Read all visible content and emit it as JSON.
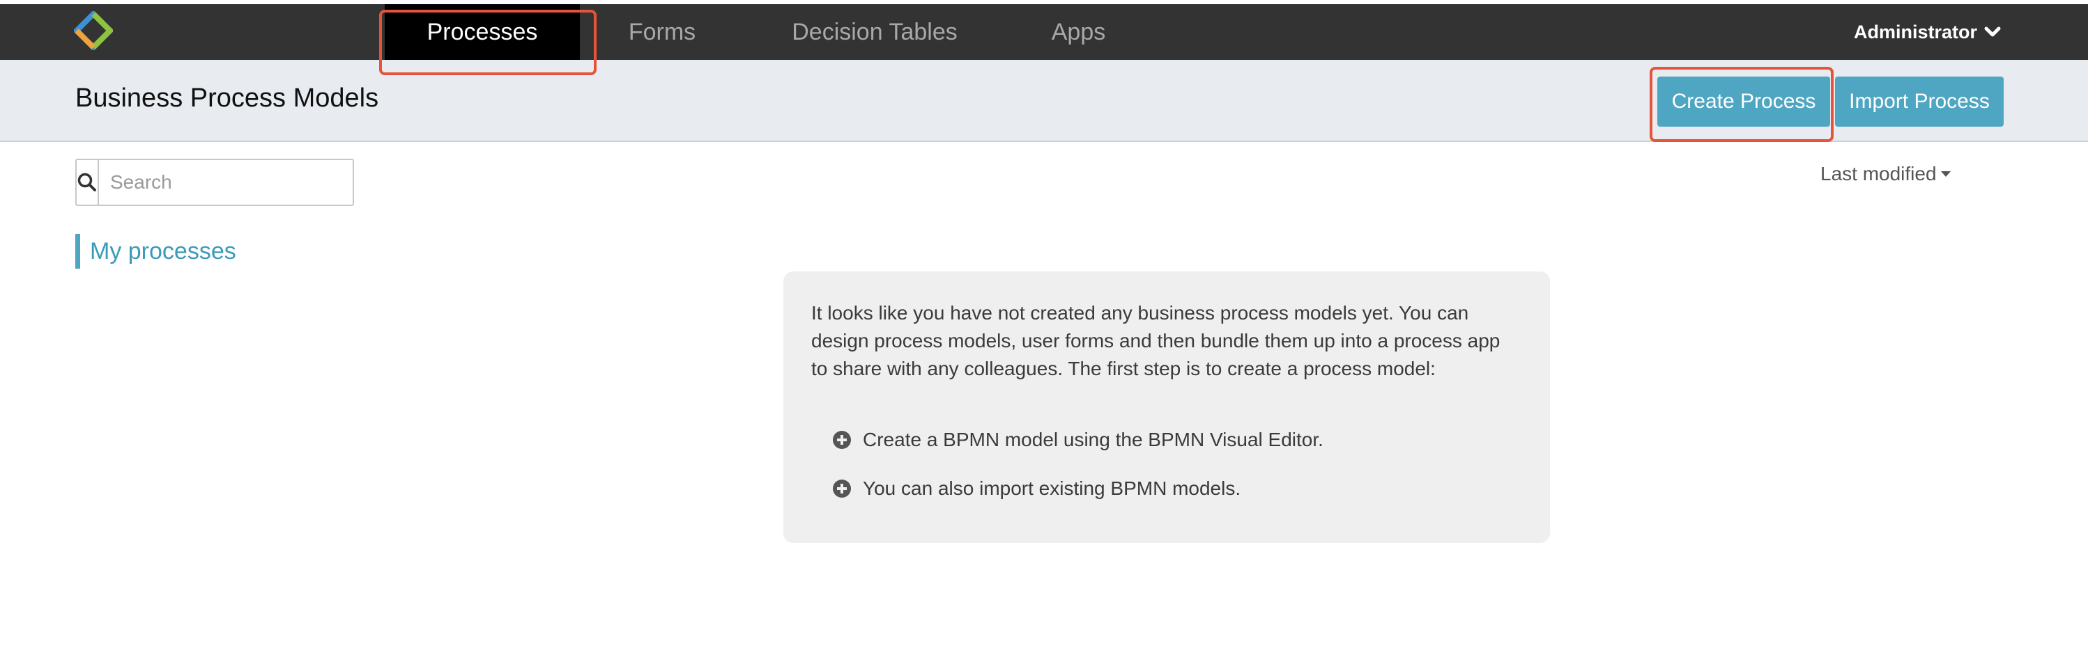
{
  "nav": {
    "tabs": [
      {
        "label": "Processes",
        "active": true
      },
      {
        "label": "Forms"
      },
      {
        "label": "Decision Tables"
      },
      {
        "label": "Apps"
      }
    ],
    "user": "Administrator",
    "logo_icon": "diamond-logo-icon"
  },
  "header": {
    "title": "Business Process Models",
    "create_label": "Create Process",
    "import_label": "Import Process"
  },
  "search": {
    "placeholder": "Search",
    "value": ""
  },
  "sort": {
    "label": "Last modified"
  },
  "filters": {
    "active": "My processes"
  },
  "empty": {
    "message": "It looks like you have not created any business process models yet. You can design process models, user forms and then bundle them up into a process app to share with any colleagues. The first step is to create a process model:",
    "items": [
      "Create a BPMN model using the BPMN Visual Editor.",
      "You can also import existing BPMN models."
    ]
  },
  "colors": {
    "navbar": "#333333",
    "accent": "#4fa6c2",
    "highlight": "#e5543a"
  }
}
